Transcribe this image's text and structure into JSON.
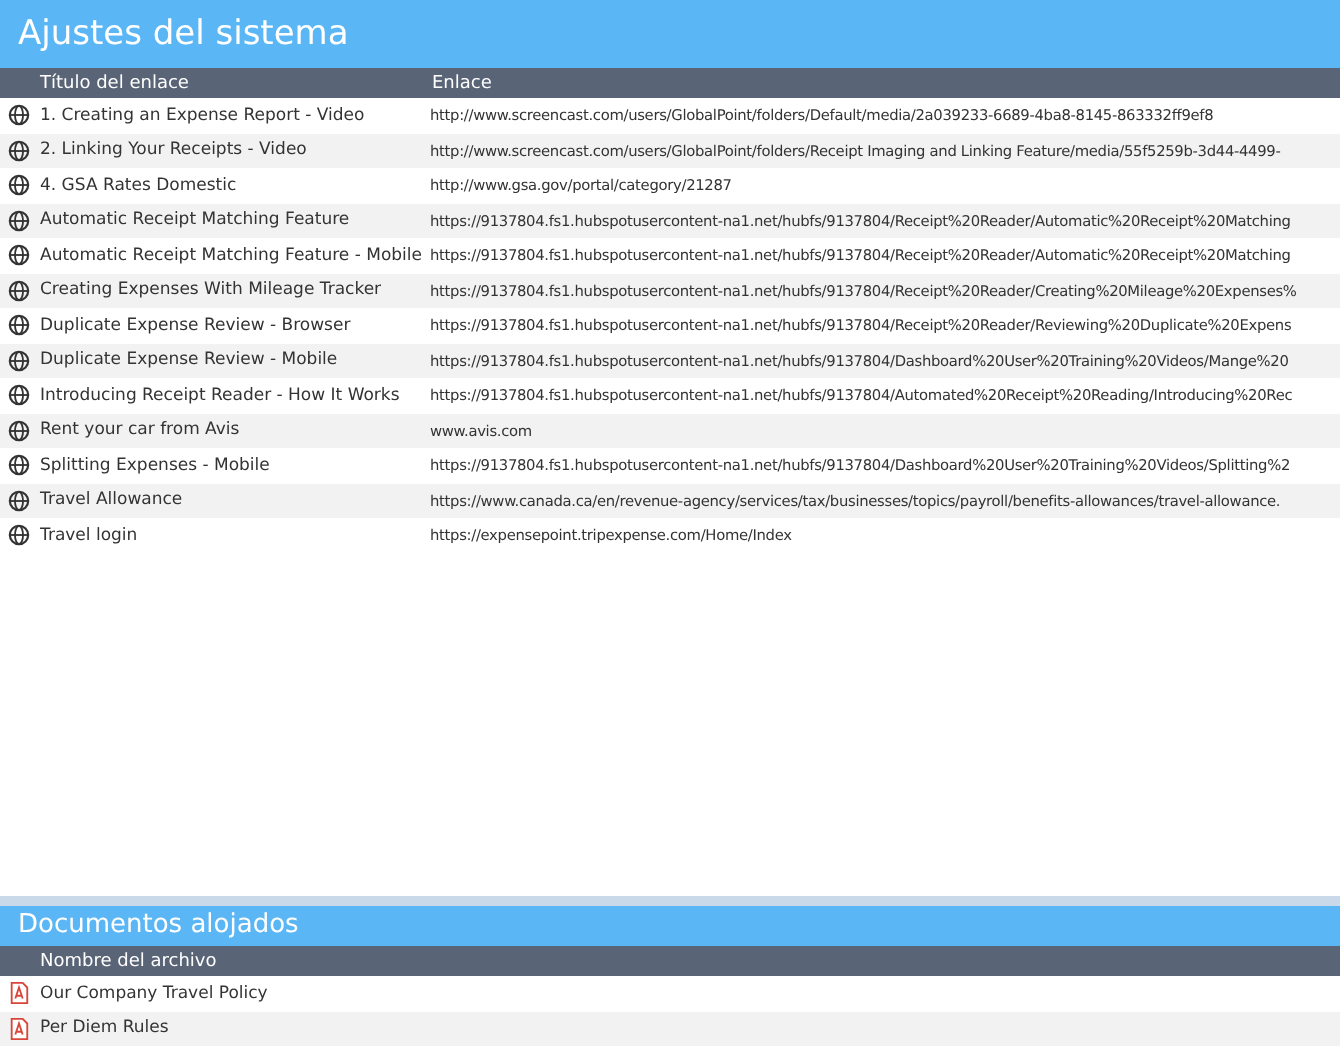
{
  "title": "Ajustes del sistema",
  "columns": [
    "Título del enlace",
    "Enlace"
  ],
  "links": [
    {
      "title": "1. Creating an Expense Report - Video",
      "url": "http://www.screencast.com/users/GlobalPoint/folders/Default/media/2a039233-6689-4ba8-8145-863332ff9ef8"
    },
    {
      "title": "2. Linking Your Receipts - Video",
      "url": "http://www.screencast.com/users/GlobalPoint/folders/Receipt Imaging and Linking Feature/media/55f5259b-3d44-4499-"
    },
    {
      "title": "4. GSA Rates Domestic",
      "url": "http://www.gsa.gov/portal/category/21287"
    },
    {
      "title": "Automatic Receipt Matching Feature",
      "url": "https://9137804.fs1.hubspotusercontent-na1.net/hubfs/9137804/Receipt%20Reader/Automatic%20Receipt%20Matching"
    },
    {
      "title": "Automatic Receipt Matching Feature - Mobile",
      "url": "https://9137804.fs1.hubspotusercontent-na1.net/hubfs/9137804/Receipt%20Reader/Automatic%20Receipt%20Matching"
    },
    {
      "title": "Creating Expenses With Mileage Tracker",
      "url": "https://9137804.fs1.hubspotusercontent-na1.net/hubfs/9137804/Receipt%20Reader/Creating%20Mileage%20Expenses%"
    },
    {
      "title": "Duplicate Expense Review - Browser",
      "url": "https://9137804.fs1.hubspotusercontent-na1.net/hubfs/9137804/Receipt%20Reader/Reviewing%20Duplicate%20Expens"
    },
    {
      "title": "Duplicate Expense Review - Mobile",
      "url": "https://9137804.fs1.hubspotusercontent-na1.net/hubfs/9137804/Dashboard%20User%20Training%20Videos/Mange%20"
    },
    {
      "title": "Introducing Receipt Reader - How It Works",
      "url": "https://9137804.fs1.hubspotusercontent-na1.net/hubfs/9137804/Automated%20Receipt%20Reading/Introducing%20Rec"
    },
    {
      "title": "Rent your car from Avis",
      "url": "www.avis.com"
    },
    {
      "title": "Splitting Expenses - Mobile",
      "url": "https://9137804.fs1.hubspotusercontent-na1.net/hubfs/9137804/Dashboard%20User%20Training%20Videos/Splitting%2"
    },
    {
      "title": "Travel Allowance",
      "url": "https://www.canada.ca/en/revenue-agency/services/tax/businesses/topics/payroll/benefits-allowances/travel-allowance."
    },
    {
      "title": "Travel login",
      "url": "https://expensepoint.tripexpense.com/Home/Index"
    }
  ],
  "docs_title": "Documentos alojados",
  "docs_column": "Nombre del archivo",
  "docs": [
    "Our Company Travel Policy",
    "Per Diem Rules"
  ]
}
